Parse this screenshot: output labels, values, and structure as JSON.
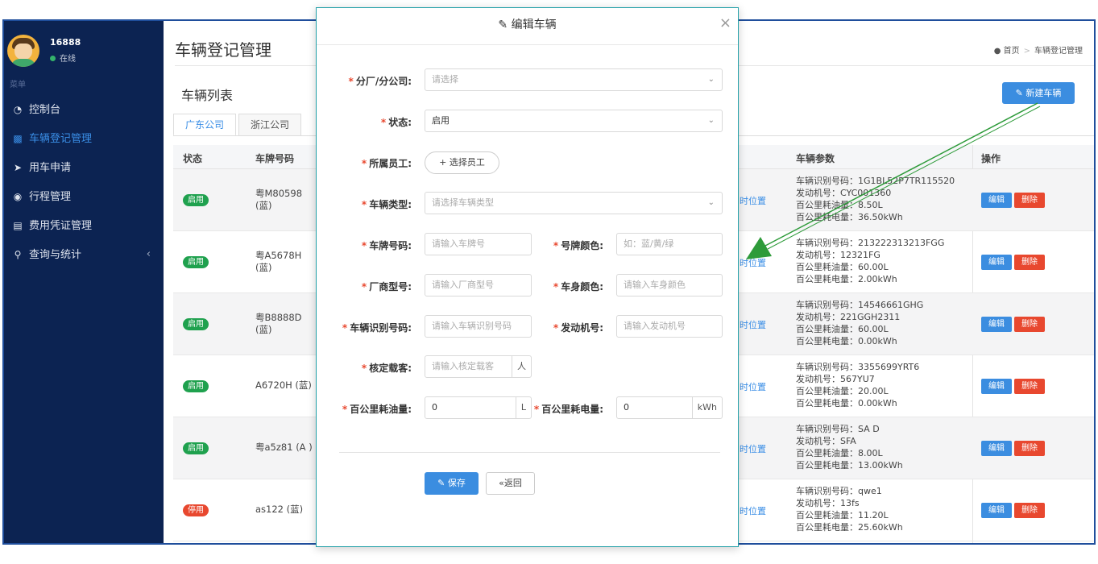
{
  "user": {
    "name": "16888",
    "status": "在线"
  },
  "sidebar": {
    "menu_title": "菜单",
    "items": [
      {
        "label": "控制台",
        "icon": "dashboard-icon"
      },
      {
        "label": "车辆登记管理",
        "icon": "car-icon",
        "active": true
      },
      {
        "label": "用车申请",
        "icon": "send-icon"
      },
      {
        "label": "行程管理",
        "icon": "binoculars-icon"
      },
      {
        "label": "费用凭证管理",
        "icon": "card-icon"
      },
      {
        "label": "查询与统计",
        "icon": "search-icon"
      }
    ]
  },
  "header": {
    "title": "车辆登记管理",
    "breadcrumb": [
      "首页",
      "车辆登记管理"
    ]
  },
  "list": {
    "title": "车辆列表",
    "new_button": "新建车辆",
    "tabs": [
      "广东公司",
      "浙江公司"
    ],
    "columns": {
      "status": "状态",
      "plate": "车牌号码",
      "params": "车辆参数",
      "ops": "操作"
    },
    "location_link": "时位置",
    "edit_label": "编辑",
    "delete_label": "删除",
    "rows": [
      {
        "status": "启用",
        "plate": "粤M80598 (蓝)",
        "p1": "车辆识别号码：1G1BL52P7TR115520",
        "p2": "发动机号：CYC001360",
        "p3": "百公里耗油量：8.50L",
        "p4": "百公里耗电量：36.50kWh"
      },
      {
        "status": "启用",
        "plate": "粤A5678H (蓝)",
        "p1": "车辆识别号码：213222313213FGG",
        "p2": "发动机号：12321FG",
        "p3": "百公里耗油量：60.00L",
        "p4": "百公里耗电量：2.00kWh"
      },
      {
        "status": "启用",
        "plate": "粤B8888D (蓝)",
        "p1": "车辆识别号码：14546661GHG",
        "p2": "发动机号：221GGH2311",
        "p3": "百公里耗油量：60.00L",
        "p4": "百公里耗电量：0.00kWh"
      },
      {
        "status": "启用",
        "plate": "A6720H (蓝)",
        "p1": "车辆识别号码：3355699YRT6",
        "p2": "发动机号：567YU7",
        "p3": "百公里耗油量：20.00L",
        "p4": "百公里耗电量：0.00kWh"
      },
      {
        "status": "启用",
        "plate": "粤a5z81 (A )",
        "p1": "车辆识别号码：SA D",
        "p2": "发动机号：SFA",
        "p3": "百公里耗油量：8.00L",
        "p4": "百公里耗电量：13.00kWh"
      },
      {
        "status": "停用",
        "plate": "as122 (蓝)",
        "p1": "车辆识别号码：qwe1",
        "p2": "发动机号：13fs",
        "p3": "百公里耗油量：11.20L",
        "p4": "百公里耗电量：25.60kWh"
      }
    ]
  },
  "modal": {
    "title": "编辑车辆",
    "branch_label": "分厂/分公司:",
    "branch_placeholder": "请选择",
    "status_label": "状态:",
    "status_value": "启用",
    "staff_label": "所属员工:",
    "staff_button": "选择员工",
    "type_label": "车辆类型:",
    "type_placeholder": "请选择车辆类型",
    "plate_label": "车牌号码:",
    "plate_placeholder": "请输入车牌号",
    "plate_color_label": "号牌颜色:",
    "plate_color_placeholder": "如：蓝/黄/绿",
    "model_label": "厂商型号:",
    "model_placeholder": "请输入厂商型号",
    "body_color_label": "车身颜色:",
    "body_color_placeholder": "请输入车身颜色",
    "vin_label": "车辆识别号码:",
    "vin_placeholder": "请输入车辆识别号码",
    "engine_label": "发动机号:",
    "engine_placeholder": "请输入发动机号",
    "seats_label": "核定载客:",
    "seats_placeholder": "请输入核定载客",
    "seats_unit": "人",
    "fuel_label": "百公里耗油量:",
    "fuel_value": "0",
    "fuel_unit": "L",
    "power_label": "百公里耗电量:",
    "power_value": "0",
    "power_unit": "kWh",
    "save_button": "保存",
    "back_button": "返回"
  },
  "colors": {
    "primary": "#3b8de0",
    "danger": "#e8482f",
    "success": "#1fa14e",
    "sidebar": "#0c2352",
    "arrow": "#2e9b3a"
  }
}
